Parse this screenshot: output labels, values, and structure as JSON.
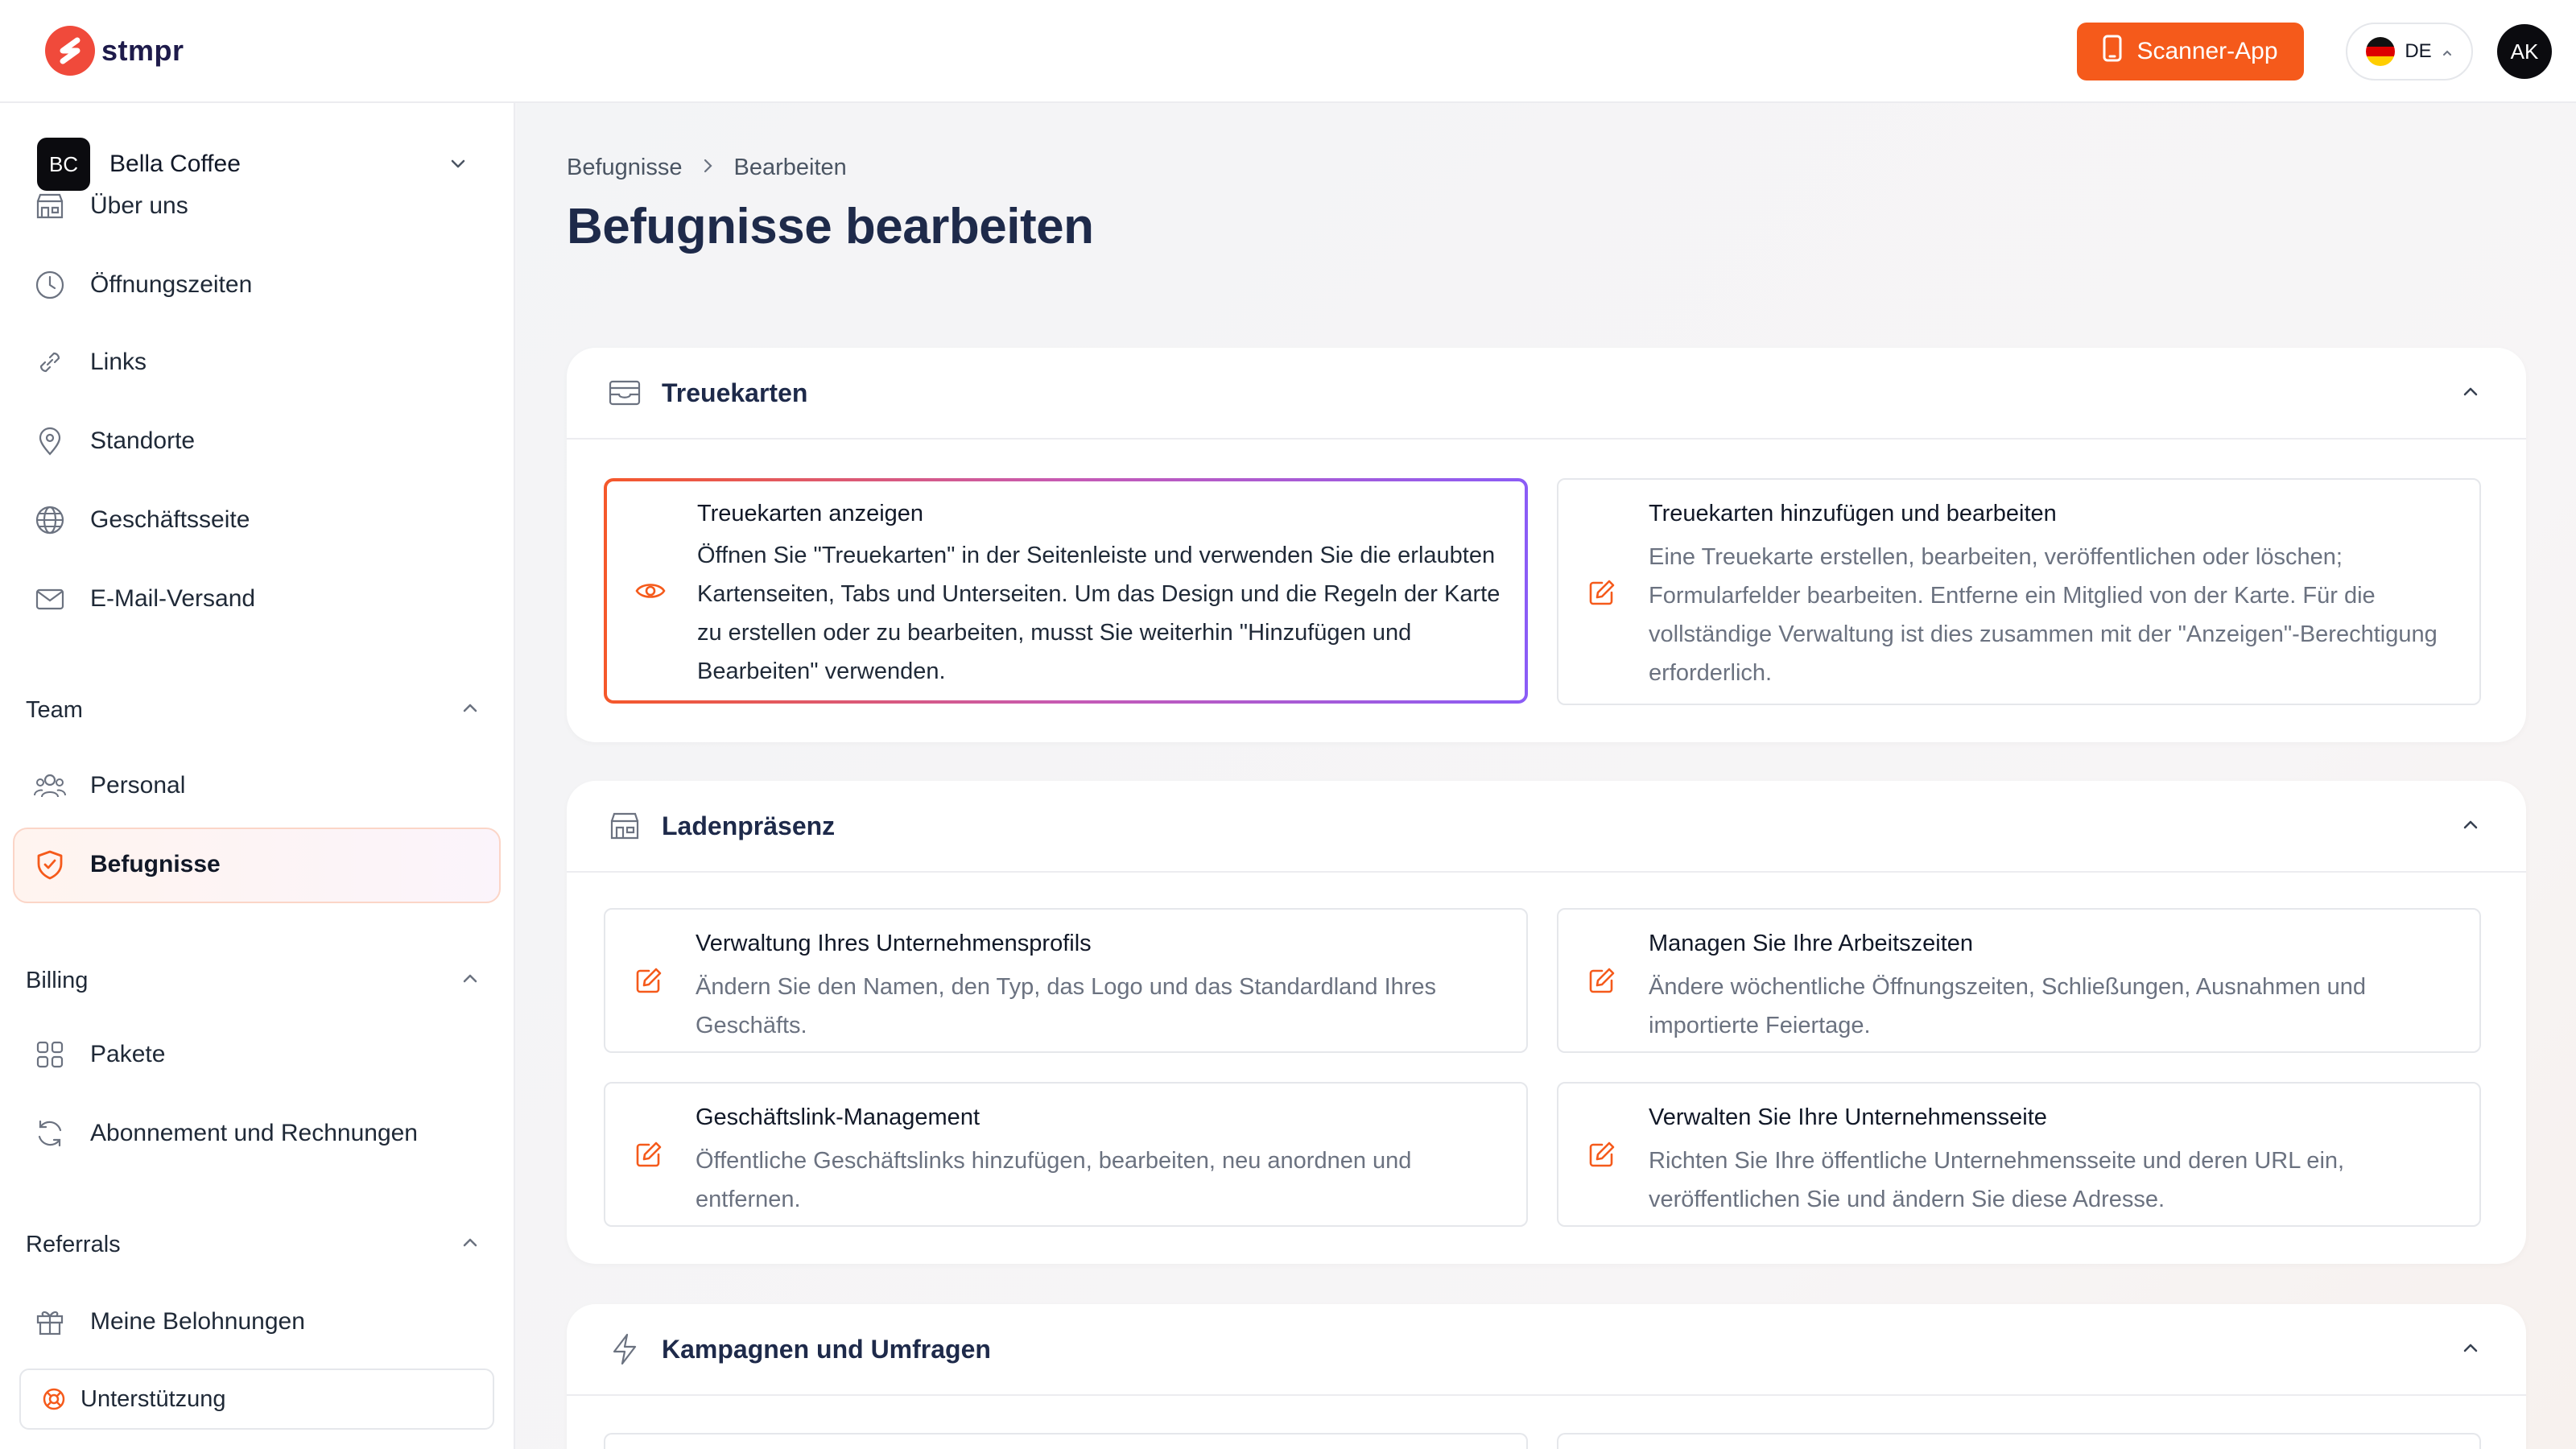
{
  "brand": {
    "name": "stmpr"
  },
  "topbar": {
    "scanner_label": "Scanner-App",
    "lang_label": "DE",
    "avatar_initials": "AK"
  },
  "sidebar": {
    "org": {
      "initials": "BC",
      "name": "Bella Coffee"
    },
    "items": [
      {
        "label": "Über uns"
      },
      {
        "label": "Öffnungszeiten"
      },
      {
        "label": "Links"
      },
      {
        "label": "Standorte"
      },
      {
        "label": "Geschäftsseite"
      },
      {
        "label": "E-Mail-Versand"
      }
    ],
    "team": {
      "heading": "Team",
      "items": [
        {
          "label": "Personal"
        },
        {
          "label": "Befugnisse"
        }
      ]
    },
    "billing": {
      "heading": "Billing",
      "items": [
        {
          "label": "Pakete"
        },
        {
          "label": "Abonnement und Rechnungen"
        }
      ]
    },
    "referrals": {
      "heading": "Referrals",
      "items": [
        {
          "label": "Meine Belohnungen"
        }
      ]
    },
    "support_label": "Unterstützung"
  },
  "main": {
    "breadcrumb": [
      "Befugnisse",
      "Bearbeiten"
    ],
    "title": "Befugnisse bearbeiten",
    "sections": [
      {
        "title": "Treuekarten",
        "permissions": [
          {
            "title": "Treuekarten anzeigen",
            "desc": "Öffnen Sie \"Treuekarten\" in der Seitenleiste und verwenden Sie die erlaubten Kartenseiten, Tabs und Unterseiten. Um das Design und die Regeln der Karte zu erstellen oder zu bearbeiten, musst Sie weiterhin \"Hinzufügen und Bearbeiten\" verwenden."
          },
          {
            "title": "Treuekarten hinzufügen und bearbeiten",
            "desc": "Eine Treuekarte erstellen, bearbeiten, veröffentlichen oder löschen; Formularfelder bearbeiten. Entferne ein Mitglied von der Karte. Für die vollständige Verwaltung ist dies zusammen mit der \"Anzeigen\"-Berechtigung erforderlich."
          }
        ]
      },
      {
        "title": "Ladenpräsenz",
        "permissions": [
          {
            "title": "Verwaltung Ihres Unternehmensprofils",
            "desc": "Ändern Sie den Namen, den Typ, das Logo und das Standardland Ihres Geschäfts."
          },
          {
            "title": "Managen Sie Ihre Arbeitszeiten",
            "desc": "Ändere wöchentliche Öffnungszeiten, Schließungen, Ausnahmen und importierte Feiertage."
          },
          {
            "title": "Geschäftslink-Management",
            "desc": "Öffentliche Geschäftslinks hinzufügen, bearbeiten, neu anordnen und entfernen."
          },
          {
            "title": "Verwalten Sie Ihre Unternehmensseite",
            "desc": "Richten Sie Ihre öffentliche Unternehmensseite und deren URL ein, veröffentlichen Sie und ändern Sie diese Adresse."
          }
        ]
      },
      {
        "title": "Kampagnen und Umfragen",
        "permissions": []
      }
    ]
  },
  "colors": {
    "accent": "#f55a1b",
    "title": "#1e2a4a",
    "selected_gradient_end": "#8b5cf6"
  }
}
